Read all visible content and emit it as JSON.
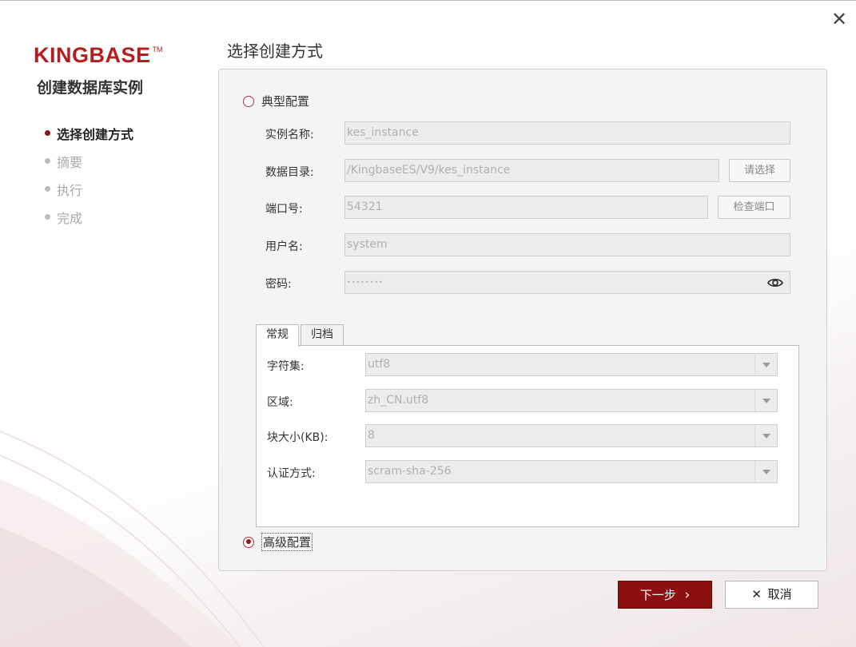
{
  "window": {
    "close_icon": "close-icon",
    "brand_color": "#b51e1e",
    "accent_color": "#8b0f0f"
  },
  "sidebar": {
    "logo": "KINGBASE",
    "logo_tm": "TM",
    "subtitle": "创建数据库实例",
    "steps": [
      {
        "label": "选择创建方式",
        "active": true
      },
      {
        "label": "摘要",
        "active": false
      },
      {
        "label": "执行",
        "active": false
      },
      {
        "label": "完成",
        "active": false
      }
    ]
  },
  "main": {
    "title": "选择创建方式",
    "typical": {
      "label": "典型配置",
      "selected": false,
      "fields": {
        "instance_name": {
          "label": "实例名称:",
          "value": "kes_instance"
        },
        "data_dir": {
          "label": "数据目录:",
          "value": "/KingbaseES/V9/kes_instance",
          "button": "请选择"
        },
        "port": {
          "label": "端口号:",
          "value": "54321",
          "button": "检查端口"
        },
        "username": {
          "label": "用户名:",
          "value": "system"
        },
        "password": {
          "label": "密码:",
          "value": "••••••••",
          "icon": "eye-icon"
        }
      },
      "tabs": [
        {
          "label": "常规",
          "active": true
        },
        {
          "label": "归档",
          "active": false
        }
      ],
      "general": {
        "charset": {
          "label": "字符集:",
          "value": "utf8"
        },
        "locale": {
          "label": "区域:",
          "value": "zh_CN.utf8"
        },
        "block_size": {
          "label": "块大小(KB):",
          "value": "8"
        },
        "auth_method": {
          "label": "认证方式:",
          "value": "scram-sha-256"
        }
      }
    },
    "advanced": {
      "label": "高级配置",
      "selected": true
    }
  },
  "footer": {
    "next": "下一步",
    "next_icon": "›",
    "cancel": "取消",
    "cancel_icon": "✕"
  }
}
